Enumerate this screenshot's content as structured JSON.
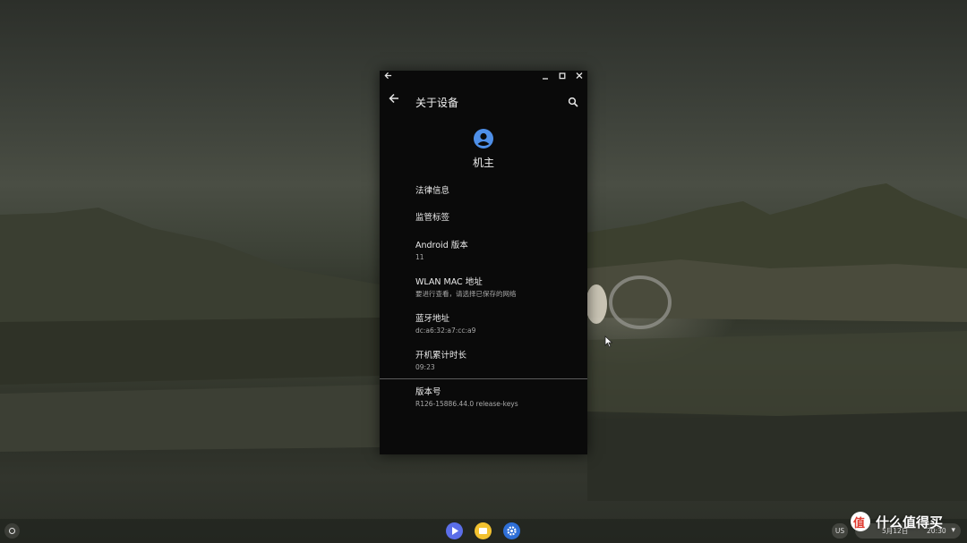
{
  "window": {
    "title_back_icon": "arrow-left-icon",
    "controls": [
      "minimize-icon",
      "maximize-icon",
      "close-icon"
    ],
    "app_title": "关于设备",
    "search_icon": "search-icon"
  },
  "owner": {
    "icon": "account-circle-icon",
    "name": "机主",
    "accent": "#4e8fe8"
  },
  "settings": [
    {
      "title": "法律信息"
    },
    {
      "title": "监管标签"
    },
    {
      "title": "Android 版本",
      "subtitle": "11"
    },
    {
      "title": "WLAN MAC 地址",
      "subtitle": "要进行查看，请选择已保存的网络"
    },
    {
      "title": "蓝牙地址",
      "subtitle": "dc:a6:32:a7:cc:a9"
    },
    {
      "title": "开机累计时长",
      "subtitle": "09:23"
    },
    {
      "title": "版本号",
      "subtitle": "R126-15886.44.0 release-keys"
    }
  ],
  "shelf": {
    "launcher_icon": "launcher-circle-icon",
    "apps": [
      {
        "name": "play-store-icon",
        "color": "#5b6ee8"
      },
      {
        "name": "files-icon",
        "color": "#f2c230"
      },
      {
        "name": "settings-gear-icon",
        "color": "#2f6fd6"
      }
    ],
    "ime": "US",
    "date": "5月12日",
    "time": "20:30"
  },
  "watermark": {
    "text": "什么值得买"
  }
}
